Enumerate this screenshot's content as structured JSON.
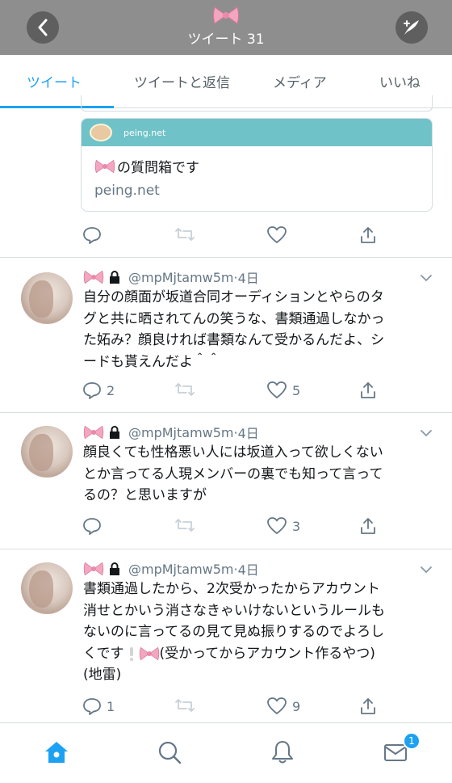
{
  "header": {
    "tweet_count_label": "ツイート 31",
    "colors": {
      "bar": "#8e8e8e",
      "button": "#5f5f5f"
    }
  },
  "tabs": [
    {
      "label": "ツイート",
      "active": true
    },
    {
      "label": "ツイートと返信",
      "active": false
    },
    {
      "label": "メディア",
      "active": false
    },
    {
      "label": "いいね",
      "active": false
    }
  ],
  "link_card": {
    "site_small": "peing.net",
    "title": "の質問箱です",
    "domain": "peing.net",
    "banner_color": "#6fc3c8"
  },
  "tweets": [
    {
      "handle": "@mpMjtamw5m",
      "time": "4日",
      "lines": [
        "自分の顔面が坂道合同オーディションとやらのタ",
        "グと共に晒されてんの笑うな、書類通過しなかっ",
        "た妬み？顔良ければ書類なんて受かるんだよ、シ",
        "ードも貰えんだよ＾＾"
      ],
      "replies": "2",
      "likes": "5"
    },
    {
      "handle": "@mpMjtamw5m",
      "time": "4日",
      "lines": [
        "顔良くても性格悪い人には坂道入って欲しくない",
        "とか言ってる人現メンバーの裏でも知って言って",
        "るの？と思いますが"
      ],
      "replies": "",
      "likes": "3"
    },
    {
      "handle": "@mpMjtamw5m",
      "time": "4日",
      "lines": [
        "書類通過したから、2次受かったからアカウント",
        "消せとかいう消さなきゃいけないというルールも",
        "ないのに言ってるの見て見ぬ振りするのでよろし",
        "くです",
        "(受かってからアカウント作るやつ)",
        "(地雷)"
      ],
      "replies": "1",
      "likes": "9"
    }
  ],
  "bottom_nav": {
    "badge_count": "1",
    "accent": "#1da1f2"
  }
}
